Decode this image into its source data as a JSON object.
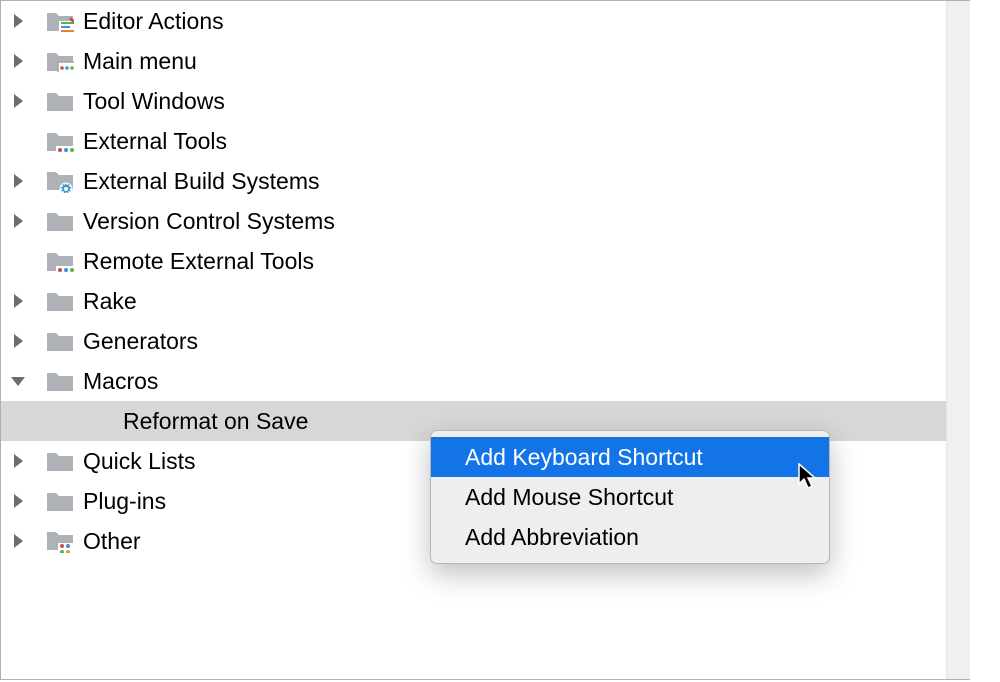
{
  "tree": {
    "editor_actions": "Editor Actions",
    "main_menu": "Main menu",
    "tool_windows": "Tool Windows",
    "external_tools": "External Tools",
    "external_build_systems": "External Build Systems",
    "version_control_systems": "Version Control Systems",
    "remote_external_tools": "Remote External Tools",
    "rake": "Rake",
    "generators": "Generators",
    "macros": "Macros",
    "macros_child": "Reformat on Save",
    "quick_lists": "Quick Lists",
    "plugins": "Plug-ins",
    "other": "Other"
  },
  "context_menu": {
    "add_keyboard": "Add Keyboard Shortcut",
    "add_mouse": "Add Mouse Shortcut",
    "add_abbr": "Add Abbreviation"
  }
}
